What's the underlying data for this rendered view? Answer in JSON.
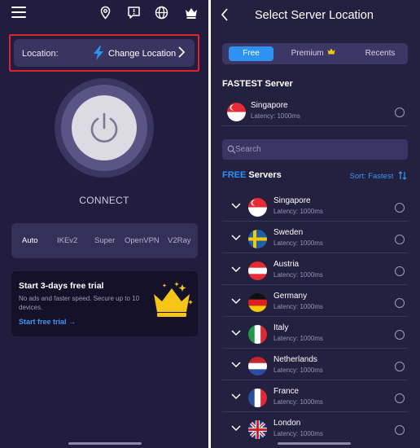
{
  "left": {
    "top_icons": [
      "menu-icon",
      "location-pin-icon",
      "feedback-icon",
      "globe-icon",
      "crown-icon"
    ],
    "location": {
      "label": "Location:",
      "action": "Change Location"
    },
    "connect_label": "CONNECT",
    "protocols": [
      "Auto",
      "IKEv2",
      "Super",
      "OpenVPN",
      "V2Ray"
    ],
    "trial": {
      "title": "Start 3-days free trial",
      "description": "No ads and faster speed. Secure up to 10 devices.",
      "link": "Start free trial →"
    }
  },
  "right": {
    "title": "Select Server Location",
    "tabs": [
      "Free",
      "Premium",
      "Recents"
    ],
    "fastest_heading": "FASTEST Server",
    "fastest": {
      "name": "Singapore",
      "latency": "Latency: 1000ms"
    },
    "search_placeholder": "Search",
    "free_heading_prefix": "FREE",
    "free_heading_suffix": " Servers",
    "sort_label": "Sort: Fastest",
    "servers": [
      {
        "name": "Singapore",
        "latency": "Latency: 1000ms"
      },
      {
        "name": "Sweden",
        "latency": "Latency: 1000ms"
      },
      {
        "name": "Austria",
        "latency": "Latency: 1000ms"
      },
      {
        "name": "Germany",
        "latency": "Latency: 1000ms"
      },
      {
        "name": "Italy",
        "latency": "Latency: 1000ms"
      },
      {
        "name": "Netherlands",
        "latency": "Latency: 1000ms"
      },
      {
        "name": "France",
        "latency": "Latency: 1000ms"
      },
      {
        "name": "London",
        "latency": "Latency: 1000ms"
      }
    ]
  },
  "colors": {
    "accent": "#2e92f2",
    "highlight_border": "#e0232e",
    "crown": "#f5c518"
  }
}
